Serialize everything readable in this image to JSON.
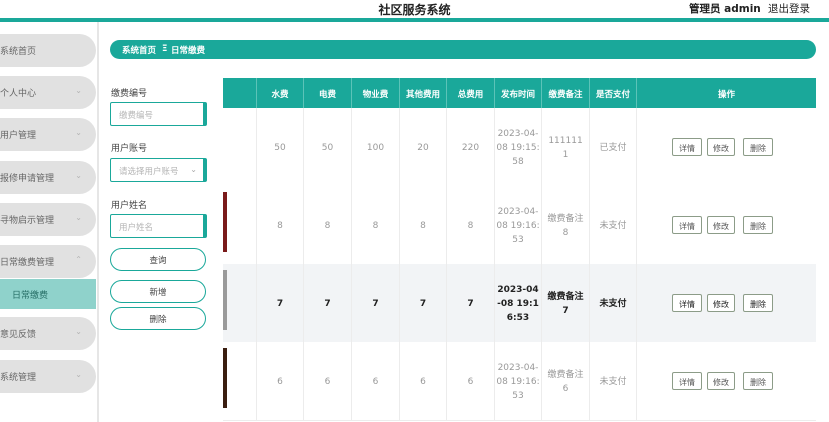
{
  "header": {
    "title": "社区服务系统",
    "admin": "管理员 admin",
    "logout": "退出登录"
  },
  "sidebar": {
    "items": [
      {
        "label": "系统首页",
        "chev": ""
      },
      {
        "label": "个人中心",
        "chev": "⌄"
      },
      {
        "label": "用户管理",
        "chev": "⌄"
      },
      {
        "label": "报修申请管理",
        "chev": "⌄"
      },
      {
        "label": "寻物启示管理",
        "chev": "⌄"
      },
      {
        "label": "日常缴费管理",
        "chev": "⌃"
      },
      {
        "label": "意见反馈",
        "chev": "⌄"
      },
      {
        "label": "系统管理",
        "chev": "⌄"
      }
    ],
    "sub_item": "日常缴费"
  },
  "breadcrumb": {
    "home": "系统首页",
    "sep": "Ξ",
    "current": "日常缴费"
  },
  "search": {
    "fields": [
      {
        "label": "缴费编号",
        "placeholder": "缴费编号"
      },
      {
        "label": "用户账号",
        "placeholder": "请选择用户账号"
      },
      {
        "label": "用户姓名",
        "placeholder": "用户姓名"
      }
    ],
    "buttons": {
      "query": "查询",
      "add": "新增",
      "delete": "删除"
    }
  },
  "table": {
    "headers": [
      "",
      "水费",
      "电费",
      "物业费",
      "其他费用",
      "总费用",
      "发布时间",
      "缴费备注",
      "是否支付",
      "操作"
    ],
    "rows": [
      {
        "water": "50",
        "electric": "50",
        "property": "100",
        "other": "20",
        "total": "220",
        "time": "2023-04-08 19:15:58",
        "note": "1111111",
        "paid": "已支付",
        "thumb": ""
      },
      {
        "water": "8",
        "electric": "8",
        "property": "8",
        "other": "8",
        "total": "8",
        "time": "2023-04-08 19:16:53",
        "note": "缴费备注8",
        "paid": "未支付",
        "thumb": "#7a1a1a"
      },
      {
        "water": "7",
        "electric": "7",
        "property": "7",
        "other": "7",
        "total": "7",
        "time": "2023-04-08 19:16:53",
        "note": "缴费备注7",
        "paid": "未支付",
        "thumb": "#9a9a9a"
      },
      {
        "water": "6",
        "electric": "6",
        "property": "6",
        "other": "6",
        "total": "6",
        "time": "2023-04-08 19:16:53",
        "note": "缴费备注6",
        "paid": "未支付",
        "thumb": "#3a1e10"
      }
    ],
    "actions": {
      "detail": "详情",
      "edit": "修改",
      "delete": "删除"
    }
  },
  "colors": {
    "accent": "#1aa89a",
    "sub_active": "#8fd2cb",
    "nav_bg": "#e1e1e1"
  }
}
